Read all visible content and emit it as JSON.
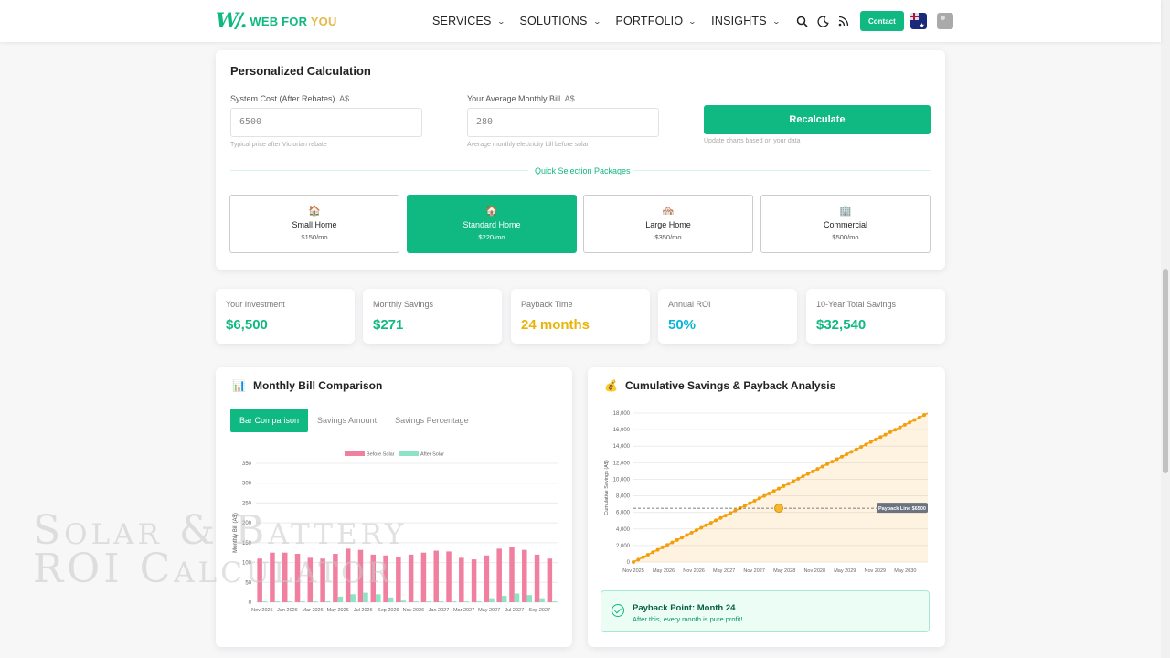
{
  "header": {
    "logo_mark": "W/.",
    "logo_text_a": "WEB FOR ",
    "logo_text_b": "YOU",
    "nav": [
      {
        "label": "SERVICES"
      },
      {
        "label": "SOLUTIONS"
      },
      {
        "label": "PORTFOLIO"
      },
      {
        "label": "INSIGHTS"
      }
    ],
    "contact_label": "Contact",
    "icons": [
      "search-icon",
      "moon-icon",
      "rss-icon"
    ],
    "brand_color": "#10b981"
  },
  "calculator": {
    "title": "Personalized Calculation",
    "system_cost": {
      "label": "System Cost (After Rebates)",
      "currency": "A$",
      "value": "6500",
      "help": "Typical price after Victorian rebate"
    },
    "monthly_bill": {
      "label": "Your Average Monthly Bill",
      "currency": "A$",
      "value": "280",
      "help": "Average monthly electricity bill before solar"
    },
    "recalc_label": "Recalculate",
    "recalc_help": "Update charts based on your data",
    "quick_label": "Quick Selection Packages",
    "packages": [
      {
        "icon": "🏠",
        "name": "Small Home",
        "price": "$150/mo",
        "active": false
      },
      {
        "icon": "🏠",
        "name": "Standard Home",
        "price": "$220/mo",
        "active": true
      },
      {
        "icon": "🏘️",
        "name": "Large Home",
        "price": "$350/mo",
        "active": false
      },
      {
        "icon": "🏢",
        "name": "Commercial",
        "price": "$500/mo",
        "active": false
      }
    ]
  },
  "stats": [
    {
      "label": "Your Investment",
      "value": "$6,500",
      "color": "#10b981"
    },
    {
      "label": "Monthly Savings",
      "value": "$271",
      "color": "#10b981"
    },
    {
      "label": "Payback Time",
      "value": "24 months",
      "color": "#eab308"
    },
    {
      "label": "Annual ROI",
      "value": "50%",
      "color": "#06b6d4"
    },
    {
      "label": "10-Year Total Savings",
      "value": "$32,540",
      "color": "#10b981"
    }
  ],
  "bill_chart": {
    "icon": "📊",
    "title": "Monthly Bill Comparison",
    "tabs": [
      {
        "label": "Bar Comparison",
        "active": true
      },
      {
        "label": "Savings Amount",
        "active": false
      },
      {
        "label": "Savings Percentage",
        "active": false
      }
    ]
  },
  "savings_chart": {
    "icon": "💰",
    "title": "Cumulative Savings & Payback Analysis",
    "payback_title": "Payback Point: Month 24",
    "payback_sub": "After this, every month is pure profit!"
  },
  "watermark": {
    "line1": "Solar & Battery",
    "line2": "ROI Calculator"
  },
  "chart_data": [
    {
      "type": "bar",
      "title": "",
      "xlabel": "",
      "ylabel": "Monthly Bill (A$)",
      "ylim": [
        0,
        350
      ],
      "yticks": [
        0,
        50,
        100,
        150,
        200,
        250,
        300,
        350
      ],
      "legend_position": "top",
      "grid": true,
      "categories": [
        "Nov 2025",
        "Dec 2025",
        "Jan 2026",
        "Feb 2026",
        "Mar 2026",
        "Apr 2026",
        "May 2026",
        "Jun 2026",
        "Jul 2026",
        "Aug 2026",
        "Sep 2026",
        "Oct 2026",
        "Nov 2026",
        "Dec 2026",
        "Jan 2027",
        "Feb 2027",
        "Mar 2027",
        "Apr 2027",
        "May 2027",
        "Jun 2027",
        "Jul 2027",
        "Aug 2027",
        "Sep 2027",
        "Oct 2027"
      ],
      "tick_labels": [
        "Nov 2025",
        "Jan 2026",
        "Mar 2026",
        "May 2026",
        "Jul 2026",
        "Sep 2026",
        "Nov 2026",
        "Jan 2027",
        "Mar 2027",
        "May 2027",
        "Jul 2027",
        "Sep 2027"
      ],
      "series": [
        {
          "name": "Before Solar",
          "color": "#f07fa0",
          "values": [
            110,
            125,
            125,
            122,
            112,
            110,
            122,
            135,
            132,
            120,
            118,
            114,
            120,
            125,
            130,
            128,
            112,
            108,
            118,
            135,
            140,
            132,
            120,
            110
          ]
        },
        {
          "name": "After Solar",
          "color": "#8ee3c4",
          "values": [
            2,
            2,
            2,
            2,
            2,
            2,
            14,
            20,
            24,
            20,
            12,
            4,
            2,
            2,
            2,
            2,
            2,
            2,
            10,
            16,
            22,
            18,
            10,
            2
          ]
        }
      ]
    },
    {
      "type": "line",
      "title": "",
      "xlabel": "",
      "ylabel": "Cumulative Savings (A$)",
      "ylim": [
        0,
        18000
      ],
      "yticks": [
        0,
        2000,
        4000,
        6000,
        8000,
        10000,
        12000,
        14000,
        16000,
        18000
      ],
      "grid": true,
      "x_tick_labels": [
        "Nov 2025",
        "May 2026",
        "Nov 2026",
        "May 2027",
        "Nov 2027",
        "May 2028",
        "Nov 2028",
        "May 2029",
        "Nov 2029",
        "May 2030"
      ],
      "series": [
        {
          "name": "Cumulative Savings",
          "color": "#f59e0b",
          "values": [
            0,
            74,
            148,
            222,
            296,
            370,
            444,
            518,
            592,
            666,
            740,
            814,
            888,
            962,
            1036,
            1110,
            1184,
            1258,
            1332,
            1406,
            1480,
            1554,
            1628,
            1702,
            1776,
            1850,
            1924,
            1998,
            2072,
            2146,
            2220,
            2294,
            2368,
            2442,
            2516,
            2590,
            2664,
            2738,
            2812,
            2886,
            2960,
            3034,
            3108,
            3182,
            3256,
            3330,
            3404,
            3478,
            3552,
            3626,
            3700,
            3774,
            3848,
            3922,
            3996,
            4070,
            4144,
            4218,
            4292,
            4366,
            4440,
            4514,
            4588,
            4662,
            4736,
            4810,
            4884,
            4958,
            5032,
            5106,
            5180,
            5254,
            5328,
            5402,
            5476,
            5550,
            5624,
            5698,
            5772,
            5846,
            5920,
            5994,
            6068,
            6142,
            6216,
            6290,
            6364,
            6438,
            6512,
            6586,
            6660,
            6734,
            6808,
            6882,
            6956,
            7030,
            7104,
            7178,
            7252,
            7326,
            7400,
            7474,
            7548,
            7622,
            7696,
            7770,
            7844,
            7918,
            7992,
            8066,
            8140,
            8214,
            8288,
            8362,
            8436,
            8510,
            8584,
            8658,
            8732,
            8806,
            8880,
            8954,
            9028,
            9102,
            9176,
            9250,
            9324,
            9398,
            9472,
            9546,
            9620,
            9694,
            9768,
            9842,
            9916,
            9990,
            10064,
            10138,
            10212,
            10286,
            10360,
            10434,
            10508,
            10582,
            10656,
            10730,
            10804,
            10878,
            10952,
            11026,
            11100,
            11174,
            11248,
            11322,
            11396,
            11470,
            11544,
            11618,
            11692,
            11766,
            11840,
            11914,
            11988,
            12062,
            12136,
            12210,
            12284,
            12358,
            12432,
            12506,
            12580,
            12654,
            12728,
            12802,
            12876,
            12950,
            13024,
            13098,
            13172,
            13246,
            13320,
            13394,
            13468,
            13542,
            13616,
            13690,
            13764,
            13838,
            13912,
            13986,
            14060,
            14134,
            14208,
            14282,
            14356,
            14430,
            14504,
            14578,
            14652,
            14726,
            14800,
            14874,
            14948,
            15022,
            15096,
            15170,
            15244,
            15318,
            15392,
            15466,
            15540,
            15614,
            15688,
            15762,
            15836,
            15910,
            15984,
            16058,
            16132,
            16206,
            16280,
            16354,
            16428,
            16502,
            16576,
            16650,
            16724,
            16798,
            16872,
            16946,
            17020,
            17094,
            17168,
            17242,
            17316,
            17390,
            17464,
            17538,
            17612,
            17686,
            17760,
            17834,
            17908,
            17982
          ]
        },
        {
          "name": "Payback Line $6500",
          "color": "#555555",
          "value": 6500
        }
      ],
      "payback_label": "Payback Line $6500",
      "payback_month": 24,
      "payback_value": 6500
    }
  ]
}
